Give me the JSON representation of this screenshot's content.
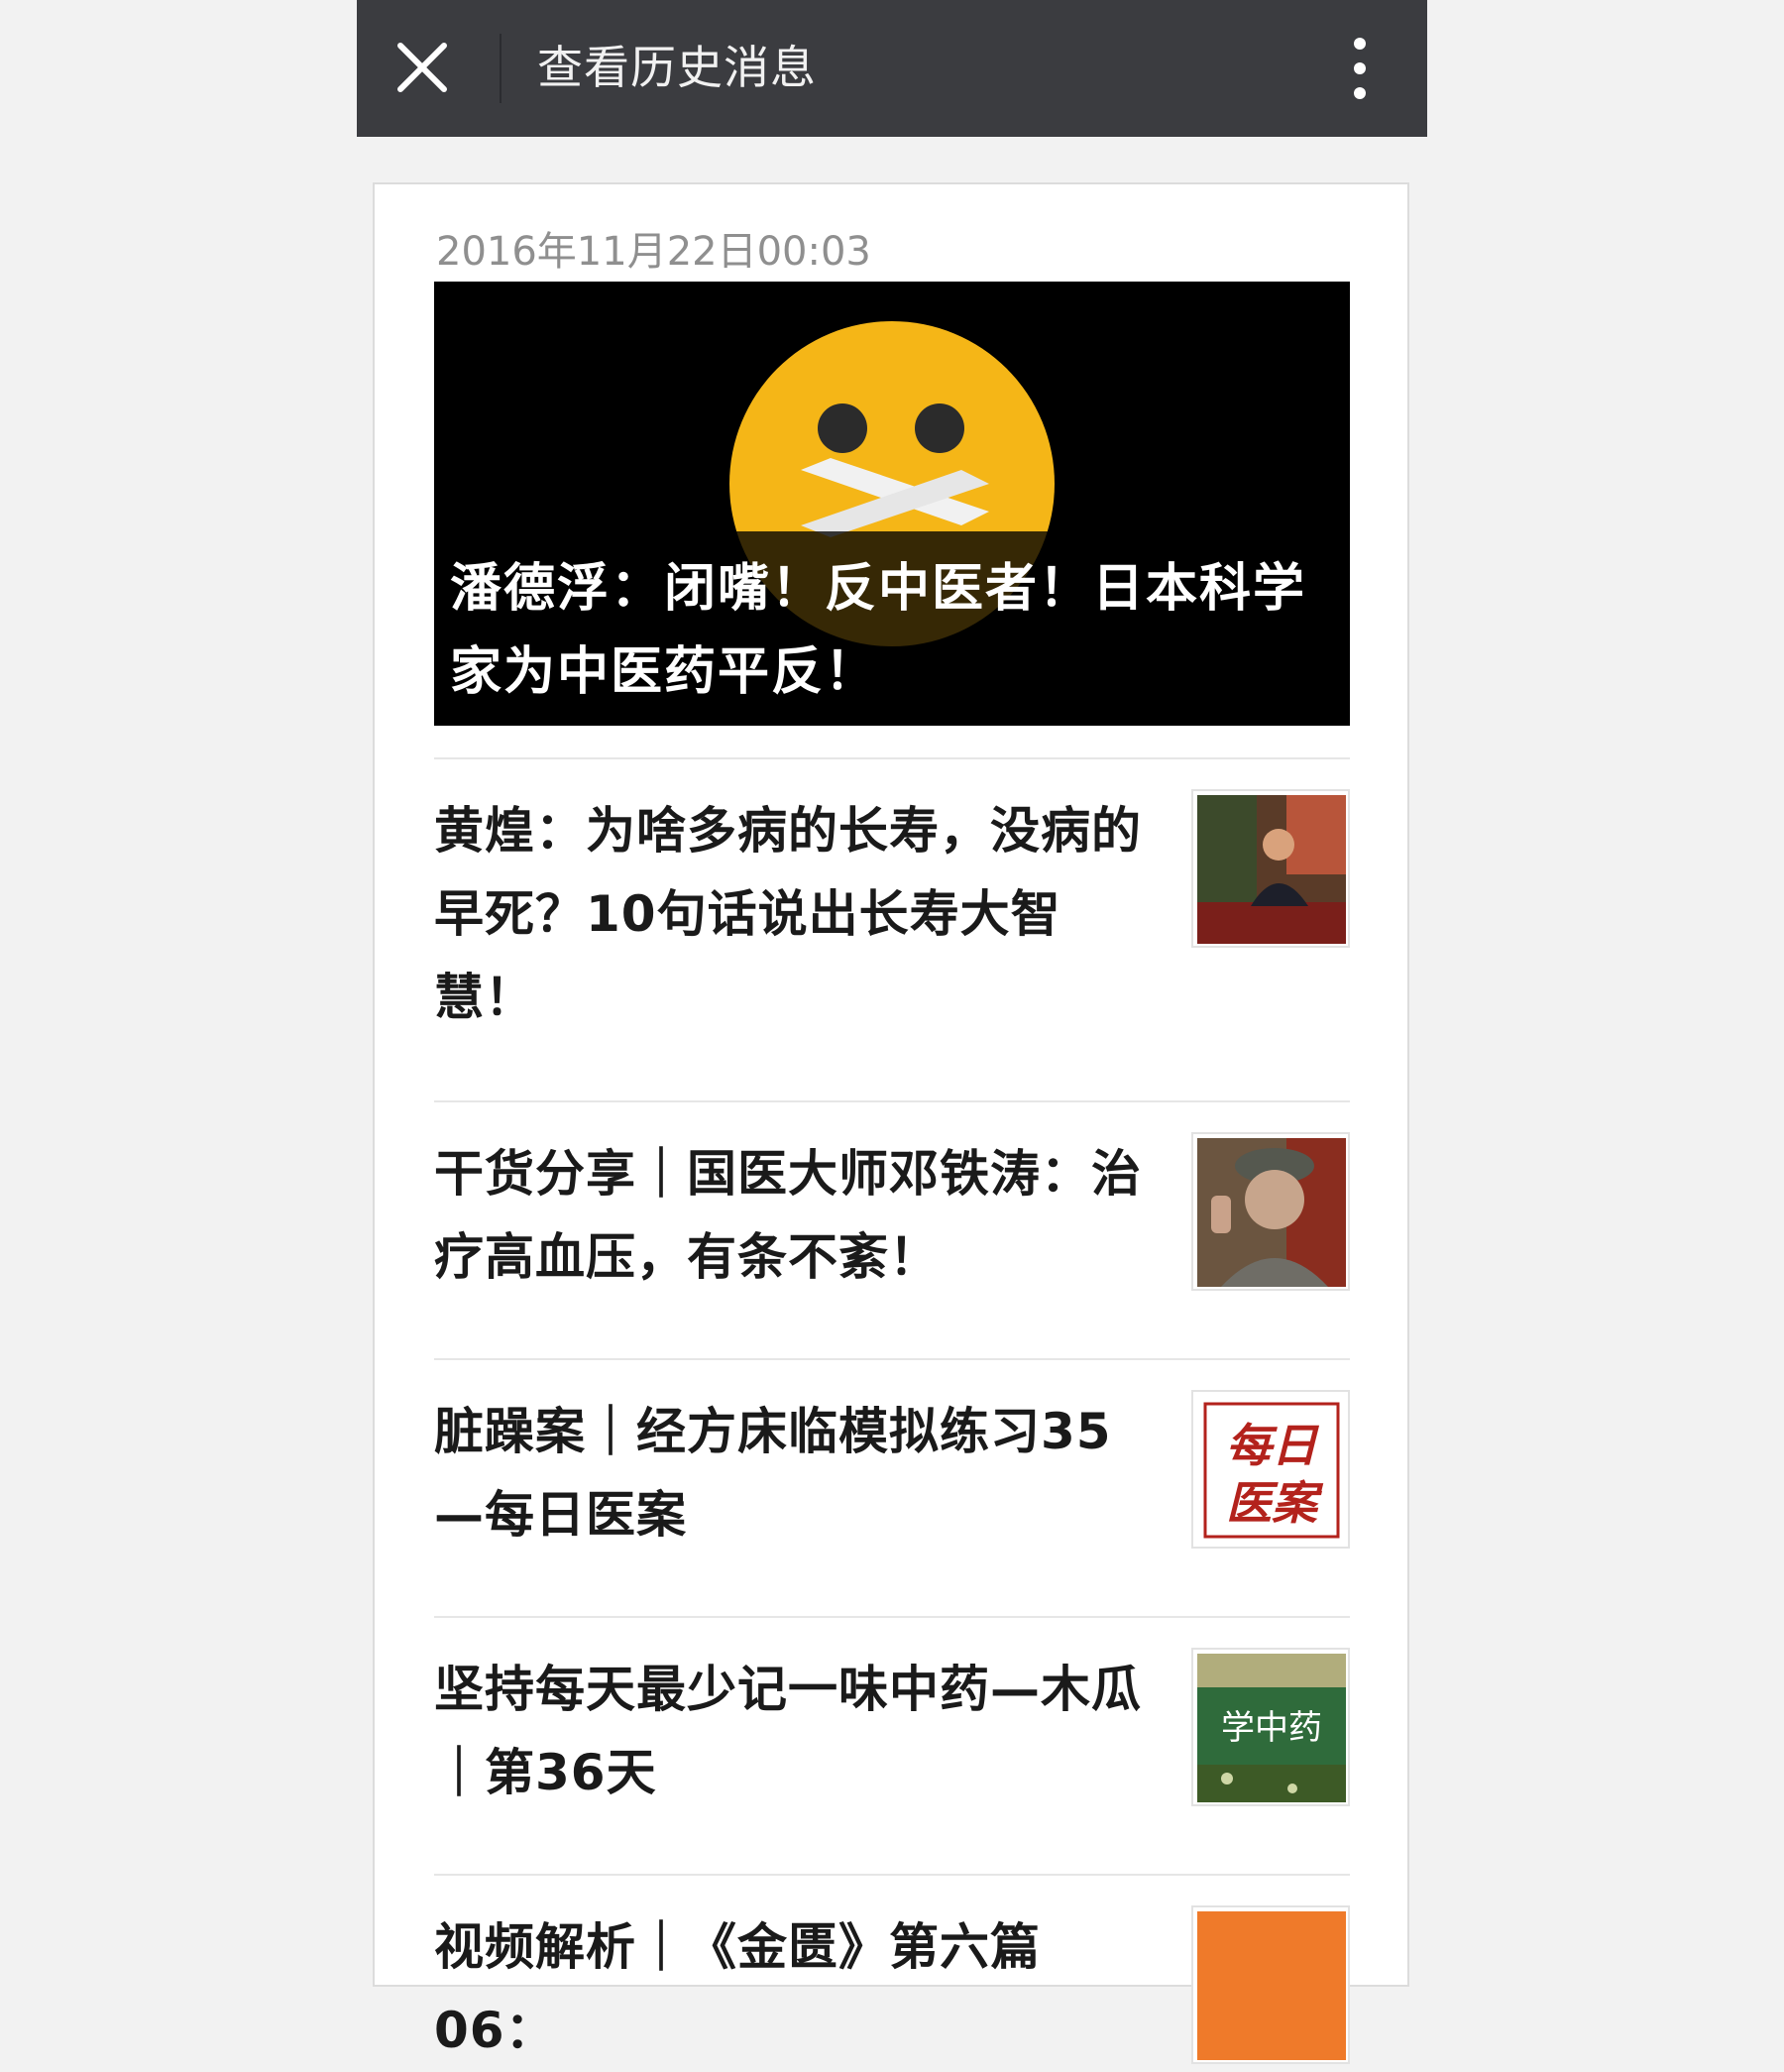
{
  "header": {
    "title": "查看历史消息"
  },
  "history": {
    "date": "2016年11月22日00:03",
    "cover": {
      "title": "潘德浮：闭嘴！反中医者！日本科学家为中医药平反！"
    },
    "articles": [
      {
        "title": "黄煌：为啥多病的长寿，没病的早死？10句话说出长寿大智慧！"
      },
      {
        "title": "干货分享｜国医大师邓铁涛：治疗高血压，有条不紊！"
      },
      {
        "title": "脏躁案｜经方床临模拟练习35—每日医案",
        "thumb_text": [
          "每日",
          "医案"
        ]
      },
      {
        "title": "坚持每天最少记一味中药—木瓜｜第36天",
        "thumb_text": "学中药"
      },
      {
        "title": "视频解析｜《金匮》第六篇06："
      }
    ]
  }
}
